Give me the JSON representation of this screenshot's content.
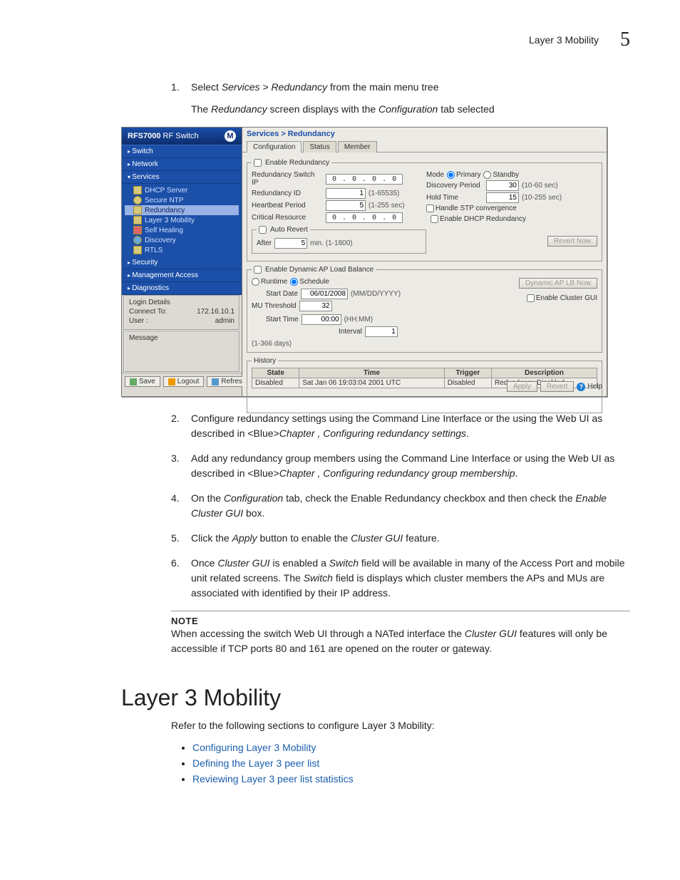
{
  "header": {
    "title": "Layer 3 Mobility",
    "page": "5"
  },
  "step1": {
    "num": "1.",
    "text_a": "Select ",
    "em": "Services > Redundancy",
    "text_b": " from the main menu tree",
    "sub_a": "The ",
    "sub_em1": "Redundancy",
    "sub_mid": " screen displays with the ",
    "sub_em2": "Configuration",
    "sub_b": " tab selected"
  },
  "shot": {
    "brand_a": "RFS7000",
    "brand_b": " RF Switch",
    "nav": {
      "switch": "Switch",
      "network": "Network",
      "services": "Services",
      "items": [
        "DHCP Server",
        "Secure NTP",
        "Redundancy",
        "Layer 3 Mobility",
        "Self Healing",
        "Discovery",
        "RTLS"
      ],
      "security": "Security",
      "mgmt": "Management Access",
      "diag": "Diagnostics"
    },
    "login": {
      "legend": "Login Details",
      "connect_lbl": "Connect To:",
      "connect_val": "172.16.10.1",
      "user_lbl": "User :",
      "user_val": "admin"
    },
    "msg_legend": "Message",
    "btns": {
      "save": "Save",
      "logout": "Logout",
      "refresh": "Refresh"
    },
    "crumb": "Services > Redundancy",
    "tabs": [
      "Configuration",
      "Status",
      "Member"
    ],
    "grp1": {
      "legend": "Enable Redundancy",
      "switch_ip_lbl": "Redundancy Switch IP",
      "ip": [
        "0",
        "0",
        "0",
        "0"
      ],
      "mode_lbl": "Mode",
      "mode_primary": "Primary",
      "mode_standby": "Standby",
      "id_lbl": "Redundancy ID",
      "id_val": "1",
      "id_hint": "(1-65535)",
      "disc_lbl": "Discovery Period",
      "disc_val": "30",
      "disc_hint": "(10-60 sec)",
      "hb_lbl": "Heartbeat Period",
      "hb_val": "5",
      "hb_hint": "(1-255 sec)",
      "hold_lbl": "Hold Time",
      "hold_val": "15",
      "hold_hint": "(10-255 sec)",
      "crit_lbl": "Critical Resource",
      "crit_ip": [
        "0",
        "0",
        "0",
        "0"
      ],
      "stp": "Handle STP convergence",
      "dhcp": "Enable DHCP Redundancy",
      "auto_legend": "Auto Revert",
      "after_lbl": "After",
      "after_val": "5",
      "after_hint": "min. (1-1800)",
      "revert_btn": "Revert Now"
    },
    "grp2": {
      "legend": "Enable Dynamic AP Load Balance",
      "runtime": "Runtime",
      "schedule": "Schedule",
      "sd_lbl": "Start Date",
      "sd_val": "06/01/2008",
      "sd_hint": "(MM/DD/YYYY)",
      "st_lbl": "Start Time",
      "st_val": "00:00",
      "st_hint": "(HH:MM)",
      "mu_lbl": "MU Threshold",
      "mu_val": "32",
      "int_lbl": "Interval",
      "int_val": "1",
      "int_hint": "(1-366 days)",
      "lb_btn": "Dynamic AP LB Now",
      "cluster": "Enable Cluster GUI"
    },
    "hist": {
      "legend": "History",
      "cols": [
        "State",
        "Time",
        "Trigger",
        "Description"
      ],
      "row": [
        "Disabled",
        "Sat Jan 06 19:03:04 2001 UTC",
        "Disabled",
        "Redundancy Disabled"
      ]
    },
    "bottom": {
      "apply": "Apply",
      "revert": "Revert",
      "help": "Help"
    }
  },
  "steps_after": [
    {
      "n": "2.",
      "a": "Configure redundancy settings using the Command Line Interface or the using the Web UI as described in <Blue>",
      "em": "Chapter , Configuring redundancy settings",
      "b": "."
    },
    {
      "n": "3.",
      "a": "Add any redundancy group members using the Command Line Interface or using the Web UI as described in <Blue>",
      "em": "Chapter , Configuring redundancy group membership",
      "b": "."
    },
    {
      "n": "4.",
      "a": "On the ",
      "em": "Configuration",
      "mid": " tab, check the Enable Redundancy checkbox and then check the ",
      "em2": "Enable Cluster GUI",
      "b": " box."
    },
    {
      "n": "5.",
      "a": "Click the ",
      "em": "Apply",
      "mid": " button to enable the ",
      "em2": "Cluster GUI",
      "b": " feature."
    },
    {
      "n": "6.",
      "a": "Once ",
      "em": "Cluster GUI",
      "mid": " is enabled a ",
      "em2": "Switch",
      "mid2": " field will be available in many of the Access Port and mobile unit related screens. The ",
      "em3": "Switch",
      "b": " field is displays which cluster members the APs and MUs are associated with identified by their IP address."
    }
  ],
  "note": {
    "label": "NOTE",
    "a": "When accessing the switch Web UI through a NATed interface the ",
    "em": "Cluster GUI",
    "b": " features will only be accessible if TCP ports 80 and 161 are opened on the router or gateway."
  },
  "section_title": "Layer 3 Mobility",
  "section_intro": "Refer to the following sections to configure Layer 3 Mobility:",
  "links": [
    "Configuring Layer 3 Mobility",
    "Defining the Layer 3 peer list",
    "Reviewing Layer 3 peer list statistics"
  ]
}
